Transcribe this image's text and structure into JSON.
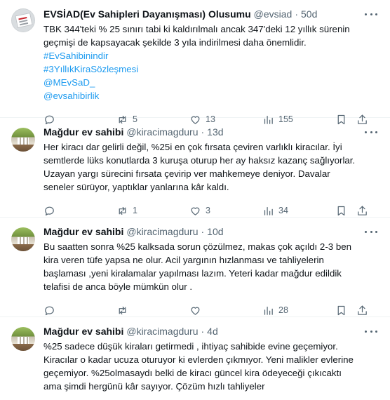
{
  "tweets": [
    {
      "name": "EVSİAD(Ev Sahipleri Dayanışması) Olusumu",
      "handle": "@evsiad",
      "dot": "·",
      "time": "50d",
      "lines": [
        "TBK 344'teki % 25 sınırı tabi ki kaldırılmalı ancak 347'deki 12 yıllık sürenin",
        "geçmişi de kapsayacak şekilde 3 yıla indirilmesi daha önemlidir."
      ],
      "tags": [
        "#EvSahibinindir",
        "#3YıllıkKiraSözleşmesi",
        "@MEvSaD_",
        "@evsahibirlik"
      ],
      "replies": "",
      "retweets": "5",
      "likes": "13",
      "views": "155"
    },
    {
      "name": "Mağdur ev sahibi",
      "handle": "@kiracimagduru",
      "dot": "·",
      "time": "13d",
      "lines": [
        "Her kiracı dar gelirli değil, %25i en çok fırsata çeviren varlıklı kiracılar. İyi",
        "semtlerde lüks konutlarda 3 kuruşa oturup her ay haksız kazanç sağlıyorlar.",
        "Uzayan yargı sürecini fırsata çevirip ver mahkemeye deniyor. Davalar",
        "seneler sürüyor, yaptıklar yanlarına kâr kaldı."
      ],
      "tags": [],
      "replies": "",
      "retweets": "1",
      "likes": "3",
      "views": "34"
    },
    {
      "name": "Mağdur ev sahibi",
      "handle": "@kiracimagduru",
      "dot": "·",
      "time": "10d",
      "lines": [
        "Bu saatten sonra %25 kalksada sorun çözülmez, makas çok açıldı 2-3 ben",
        "kira veren tüfe yapsa ne olur. Acil yargının hızlanması ve tahliyelerin",
        "başlaması ,yeni kiralamalar yapılması lazım. Yeteri kadar mağdur edildik",
        "telafisi de anca böyle mümkün olur ."
      ],
      "tags": [],
      "replies": "",
      "retweets": "",
      "likes": "",
      "views": "28"
    },
    {
      "name": "Mağdur ev sahibi",
      "handle": "@kiracimagduru",
      "dot": "·",
      "time": "4d",
      "lines": [
        "%25 sadece düşük kiraları getirmedi , ihtiyaç sahibide evine geçemiyor.",
        "Kiracılar o kadar ucuza oturuyor ki evlerden çıkmıyor. Yeni malikler evlerine",
        "geçemiyor. %25olmasaydı belki de kiracı güncel kira ödeyeceği çıkıcaktı",
        "ama şimdi hergünü kâr sayıyor. Çözüm hızlı tahliyeler"
      ],
      "tags": [],
      "replies": "",
      "retweets": "",
      "likes": "",
      "views": ""
    }
  ]
}
